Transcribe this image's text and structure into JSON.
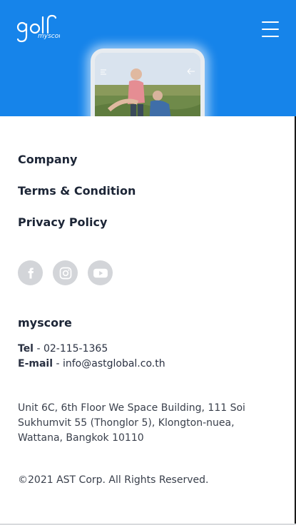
{
  "header": {
    "logo_text": "golf",
    "logo_sub": "myscore",
    "bg_color": "#1684ea"
  },
  "nav": {
    "company": "Company",
    "terms": "Terms & Condition",
    "privacy": "Privacy Policy"
  },
  "social": [
    "facebook-icon",
    "instagram-icon",
    "youtube-icon"
  ],
  "contact": {
    "brand": "myscore",
    "tel_label": "Tel",
    "tel_value": "02-115-1365",
    "email_label": "E-mail",
    "email_value": "info@astglobal.co.th",
    "address": "Unit 6C, 6th Floor We Space Building, 111 Soi Sukhumvit 55 (Thonglor 5), Klongton-nuea, Wattana, Bangkok 10110"
  },
  "footer": {
    "copyright": "©2021 AST Corp. All Rights Reserved."
  }
}
